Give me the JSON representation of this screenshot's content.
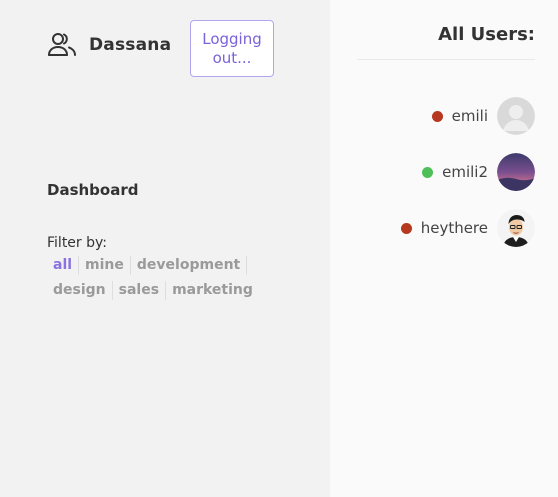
{
  "brand": {
    "name": "Dassana",
    "icon": "users-icon"
  },
  "header": {
    "logout_label": "Logging out..."
  },
  "dashboard": {
    "title": "Dashboard",
    "filter_label": "Filter by:",
    "filters": [
      {
        "label": "all",
        "active": true
      },
      {
        "label": "mine",
        "active": false
      },
      {
        "label": "development",
        "active": false
      },
      {
        "label": "design",
        "active": false
      },
      {
        "label": "sales",
        "active": false
      },
      {
        "label": "marketing",
        "active": false
      }
    ]
  },
  "users_panel": {
    "title": "All Users:",
    "users": [
      {
        "name": "emili",
        "status": "offline",
        "status_color": "#b5381f",
        "avatar": "default-avatar"
      },
      {
        "name": "emili2",
        "status": "online",
        "status_color": "#4fbf5a",
        "avatar": "purple-sky-avatar"
      },
      {
        "name": "heythere",
        "status": "offline",
        "status_color": "#b5381f",
        "avatar": "cartoon-man-avatar"
      }
    ]
  },
  "colors": {
    "accent": "#8a72e0",
    "button_border": "#b3a6ef",
    "online": "#4fbf5a",
    "offline": "#b5381f"
  }
}
